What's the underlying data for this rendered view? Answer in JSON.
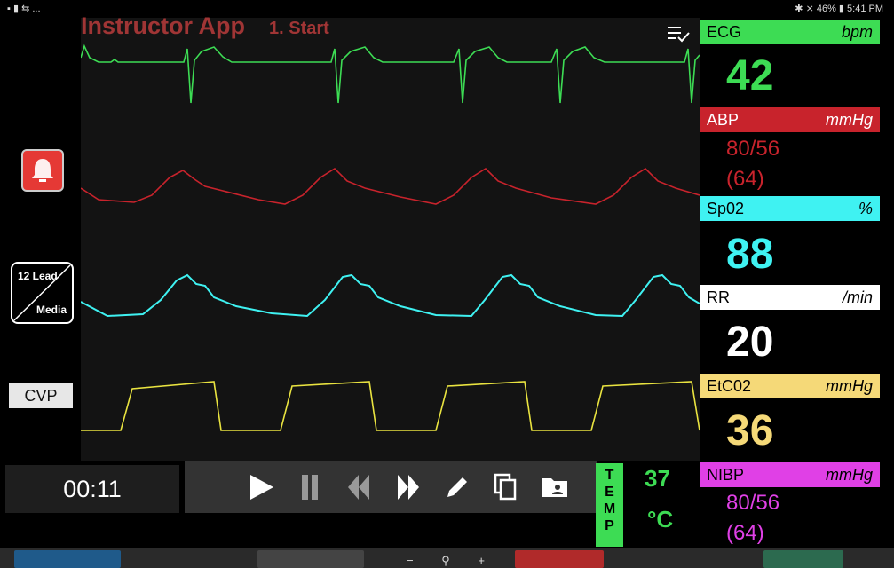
{
  "status_bar": {
    "left": "▪ ▮ ⇆ ...",
    "right": "✱ ⨯ 46% ▮ 5:41 PM"
  },
  "app": {
    "title": "Instructor App",
    "preset": "1. Start"
  },
  "left_panel": {
    "lead_top": "12 Lead",
    "lead_bottom": "Media",
    "cvp_label": "CVP"
  },
  "timer": "00:11",
  "temp": {
    "label": [
      "T",
      "E",
      "M",
      "P"
    ],
    "value": "37",
    "unit": "°C"
  },
  "vitals": {
    "ecg": {
      "label": "ECG",
      "unit": "bpm",
      "value": "42",
      "color": "#3ddc54"
    },
    "abp": {
      "label": "ABP",
      "unit": "mmHg",
      "line1": "80/56",
      "line2": "(64)",
      "color": "#c8232c"
    },
    "spo2": {
      "label": "Sp02",
      "unit": "%",
      "value": "88",
      "color": "#3ff2f2"
    },
    "rr": {
      "label": "RR",
      "unit": "/min",
      "value": "20",
      "color": "#ffffff"
    },
    "etco2": {
      "label": "EtC02",
      "unit": "mmHg",
      "value": "36",
      "color": "#f5d978"
    },
    "nibp": {
      "label": "NIBP",
      "unit": "mmHg",
      "line1": "80/56",
      "line2": "(64)",
      "color": "#e040e6"
    }
  },
  "controls": [
    "play-icon",
    "pause-icon",
    "rewind-icon",
    "fast-forward-icon",
    "pencil-icon",
    "copy-icon",
    "folder-user-icon"
  ]
}
